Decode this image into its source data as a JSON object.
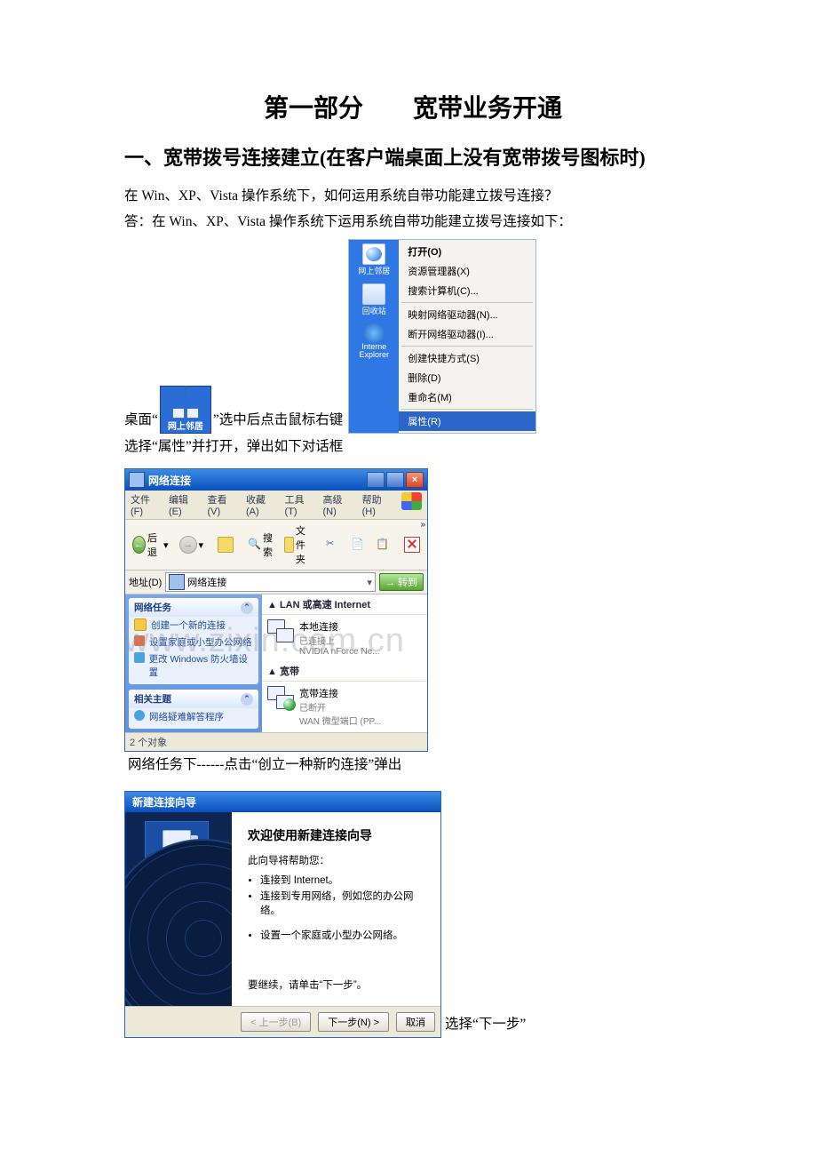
{
  "doc": {
    "part_title": "第一部分　　宽带业务开通",
    "section_title": "一、宽带拨号连接建立(在客户端桌面上没有宽带拨号图标时)",
    "q": "在 Win、XP、Vista 操作系统下，如何运用系统自带功能建立拨号连接？",
    "a": "答：在 Win、XP、Vista 操作系统下运用系统自带功能建立拨号连接如下：",
    "line1a": "桌面“",
    "line1b": "”选中后点击鼠标右键",
    "line1c": "选择“属性”并打开，弹出如下对话框",
    "line2": "网络任务下------点击“创立一种新旳连接”弹出",
    "line3": "选择“下一步”"
  },
  "tile": {
    "label": "网上邻居"
  },
  "side_icons": {
    "net": "网上邻居",
    "bin": "回收站",
    "ie": "Interne Explorer"
  },
  "context_menu": {
    "open": "打开(O)",
    "explorer": "资源管理器(X)",
    "search": "搜索计算机(C)...",
    "map": "映射网络驱动器(N)...",
    "disconnect": "断开网络驱动器(I)...",
    "shortcut": "创建快捷方式(S)",
    "delete": "删除(D)",
    "rename": "重命名(M)",
    "properties": "属性(R)"
  },
  "netwin": {
    "title": "网络连接",
    "menu": {
      "file": "文件(F)",
      "edit": "编辑(E)",
      "view": "查看(V)",
      "fav": "收藏(A)",
      "tools": "工具(T)",
      "adv": "高级(N)",
      "help": "帮助(H)"
    },
    "toolbar": {
      "back": "后退",
      "search": "搜索",
      "folders": "文件夹"
    },
    "addr": {
      "label": "地址(D)",
      "value": "网络连接",
      "go": "转到"
    },
    "tasks_title": "网络任务",
    "tasks": {
      "new": "创建一个新的连接",
      "home": "设置家庭或小型办公网络",
      "fw": "更改 Windows 防火墙设置"
    },
    "related_title": "相关主题",
    "related": {
      "help": "网络疑难解答程序"
    },
    "group_lan": "LAN 或高速 Internet",
    "lan": {
      "name": "本地连接",
      "status": "已连接上",
      "dev": "NVIDIA nForce Ne..."
    },
    "group_bb": "宽带",
    "bb": {
      "name": "宽带连接",
      "status": "已断开",
      "dev": "WAN 微型端口 (PP..."
    },
    "status": "2 个对象"
  },
  "wizard": {
    "title": "新建连接向导",
    "heading": "欢迎使用新建连接向导",
    "intro": "此向导将帮助您：",
    "b1": "连接到 Internet。",
    "b2": "连接到专用网络，例如您的办公网络。",
    "b3": "设置一个家庭或小型办公网络。",
    "cont": "要继续，请单击“下一步”。",
    "back": "< 上一步(B)",
    "next": "下一步(N) >",
    "cancel": "取消"
  },
  "watermark": "www.zixin.com.cn"
}
